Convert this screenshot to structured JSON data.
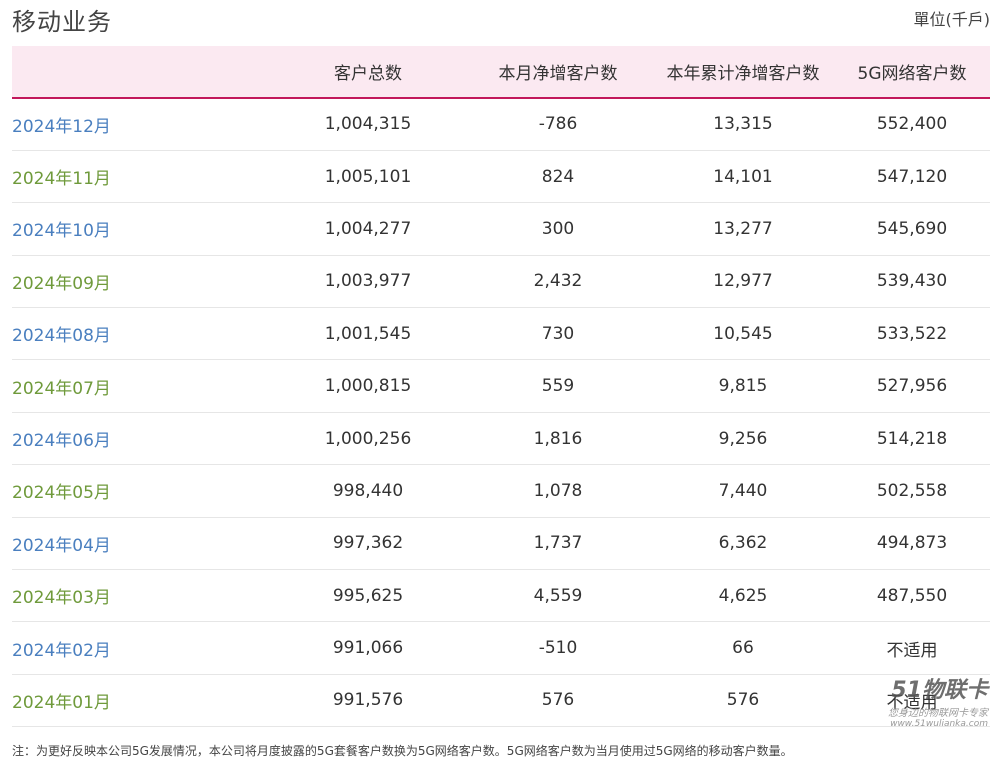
{
  "header": {
    "title": "移动业务",
    "unit": "單位(千戶)"
  },
  "table": {
    "columns": [
      "",
      "客户总数",
      "本月净增客户数",
      "本年累计净增客户数",
      "5G网络客户数"
    ],
    "rows": [
      [
        "2024年12月",
        "1,004,315",
        "-786",
        "13,315",
        "552,400"
      ],
      [
        "2024年11月",
        "1,005,101",
        "824",
        "14,101",
        "547,120"
      ],
      [
        "2024年10月",
        "1,004,277",
        "300",
        "13,277",
        "545,690"
      ],
      [
        "2024年09月",
        "1,003,977",
        "2,432",
        "12,977",
        "539,430"
      ],
      [
        "2024年08月",
        "1,001,545",
        "730",
        "10,545",
        "533,522"
      ],
      [
        "2024年07月",
        "1,000,815",
        "559",
        "9,815",
        "527,956"
      ],
      [
        "2024年06月",
        "1,000,256",
        "1,816",
        "9,256",
        "514,218"
      ],
      [
        "2024年05月",
        "998,440",
        "1,078",
        "7,440",
        "502,558"
      ],
      [
        "2024年04月",
        "997,362",
        "1,737",
        "6,362",
        "494,873"
      ],
      [
        "2024年03月",
        "995,625",
        "4,559",
        "4,625",
        "487,550"
      ],
      [
        "2024年02月",
        "991,066",
        "-510",
        "66",
        "不适用"
      ],
      [
        "2024年01月",
        "991,576",
        "576",
        "576",
        "不适用"
      ]
    ]
  },
  "note": "注：为更好反映本公司5G发展情况，本公司将月度披露的5G套餐客户数换为5G网络客户数。5G网络客户数为当月使用过5G网络的移动客户数量。",
  "watermark": {
    "logo": "51物联卡",
    "slogan": "您身边的物联网卡专家",
    "url": "www.51wulianka.com"
  },
  "colors": {
    "header_bg": "#fbe9f1",
    "header_border": "#c2185b",
    "month_blue": "#4a7fbf",
    "month_green": "#6f9a3b"
  }
}
